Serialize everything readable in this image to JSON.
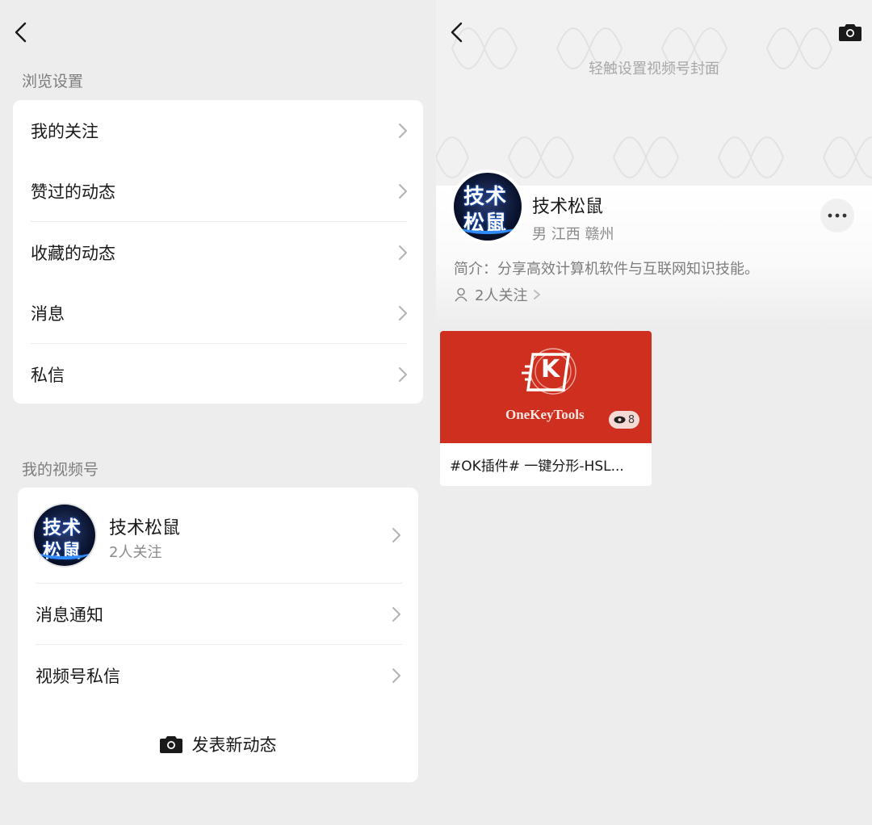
{
  "left": {
    "browse_section_title": "浏览设置",
    "browse_items": [
      {
        "label": "我的关注"
      },
      {
        "label": "赞过的动态"
      },
      {
        "label": "收藏的动态"
      },
      {
        "label": "消息"
      },
      {
        "label": "私信"
      }
    ],
    "channel_section_title": "我的视频号",
    "channel": {
      "avatar_text_top": "技术",
      "avatar_text_bottom": "松鼠",
      "name": "技术松鼠",
      "followers": "2人关注"
    },
    "channel_items": [
      {
        "label": "消息通知"
      },
      {
        "label": "视频号私信"
      }
    ],
    "post_button_label": "发表新动态"
  },
  "right": {
    "cover_hint": "轻触设置视频号封面",
    "profile": {
      "avatar_text_top": "技术",
      "avatar_text_bottom": "松鼠",
      "name": "技术松鼠",
      "meta": "男 江西 赣州",
      "bio": "简介：分享高效计算机软件与互联网知识技能。",
      "followers": "2人关注"
    },
    "video": {
      "logo_letter": "K",
      "brand": "OneKeyTools",
      "views": "8",
      "caption": "#OK插件#  一键分形-HSL..."
    }
  },
  "icons": [
    "back-arrow-icon",
    "chevron-right-icon",
    "camera-icon",
    "more-dots-icon",
    "person-icon",
    "eye-icon"
  ],
  "colors": {
    "background": "#ededed",
    "card": "#ffffff",
    "secondary_text": "#7d7d7d",
    "video_thumb_red": "#cf2f1e"
  }
}
